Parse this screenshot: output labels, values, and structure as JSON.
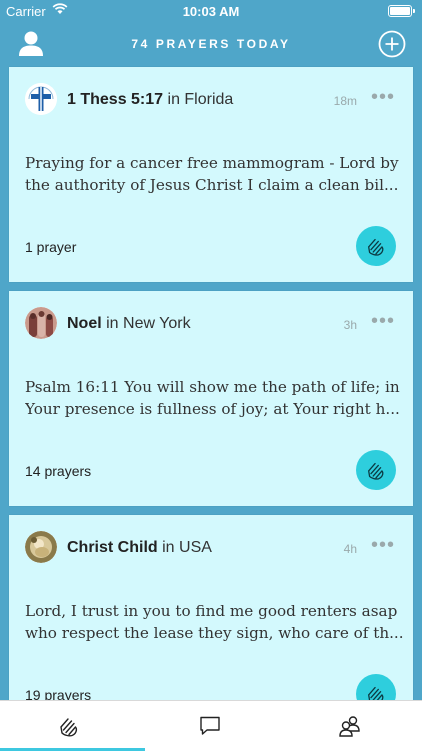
{
  "status_bar": {
    "carrier": "Carrier",
    "time": "10:03 AM"
  },
  "header": {
    "title": "74 PRAYERS TODAY",
    "left_icon": "profile-icon",
    "right_icon": "add-circle-icon"
  },
  "cards": [
    {
      "name": "1 Thess 5:17",
      "location_prefix": " in ",
      "location": "Florida",
      "time": "18m",
      "text_line1": "Praying for a cancer free mammogram - Lord by",
      "text_line2": "the authority of Jesus Christ I claim a clean bil...",
      "prayer_count": "1 prayer"
    },
    {
      "name": "Noel",
      "location_prefix": " in ",
      "location": "New York",
      "time": "3h",
      "text_line1": "Psalm 16:11 You will show me the path of life; in",
      "text_line2": "Your presence is fullness of joy; at Your right h...",
      "prayer_count": "14 prayers"
    },
    {
      "name": "Christ Child",
      "location_prefix": " in ",
      "location": "USA",
      "time": "4h",
      "text_line1": "Lord, I trust in you to find me good renters asap",
      "text_line2": "who respect the lease they sign, who care of th...",
      "prayer_count": "19 prayers"
    }
  ],
  "more_glyph": "•••",
  "tab_bar": {
    "tabs": [
      "praying-hands-icon",
      "chat-bubble-icon",
      "community-icon"
    ],
    "selected": 0
  },
  "colors": {
    "background": "#4fa6c9",
    "card": "#d3f9fd",
    "accent": "#2ecedd"
  }
}
